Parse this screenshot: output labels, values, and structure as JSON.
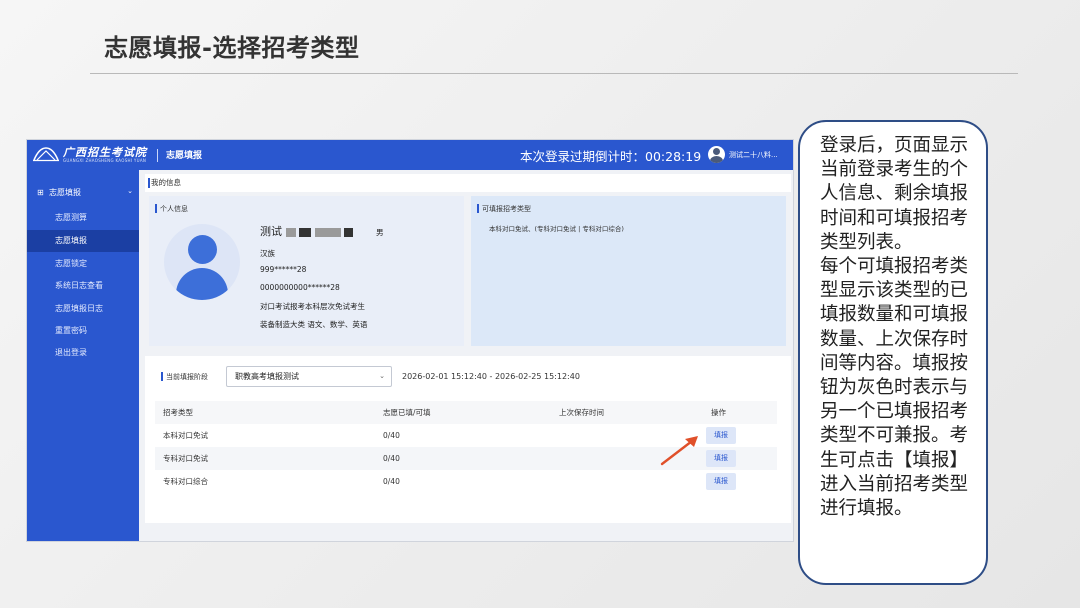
{
  "slide": {
    "title": "志愿填报-选择招考类型"
  },
  "app": {
    "logo_text": "广西招生考试院",
    "logo_subtitle": "GUANGXI ZHAOSHENG KAOSHI YUAN",
    "module_title": "志愿填报",
    "countdown_label": "本次登录过期倒计时：",
    "countdown_value": "00:28:19",
    "user_name": "测试二十八料..."
  },
  "sidebar": {
    "group_label": "志愿填报",
    "items": [
      {
        "label": "志愿测算"
      },
      {
        "label": "志愿填报"
      },
      {
        "label": "志愿锁定"
      },
      {
        "label": "系统日志查看"
      },
      {
        "label": "志愿填报日志"
      },
      {
        "label": "重置密码"
      },
      {
        "label": "退出登录"
      }
    ]
  },
  "my_info": {
    "header": "我的信息",
    "personal_title": "个人信息",
    "name": "测试",
    "gender": "男",
    "ethnicity": "汉族",
    "exam_number": "999******28",
    "id_number": "0000000000******28",
    "category": "对口考试报考本科层次免试考生",
    "subjects": "装备制造大类    语文、数学、英语",
    "types_title": "可填报招考类型",
    "types_text": "本科对口免试、(专科对口免试 | 专科对口综合)"
  },
  "apply": {
    "stage_label": "当前填报阶段",
    "stage_value": "职教高考填报测试",
    "stage_range": "2026-02-01 15:12:40 - 2026-02-25 15:12:40",
    "columns": [
      "招考类型",
      "志愿已填/可填",
      "上次保存时间",
      "操作"
    ],
    "rows": [
      {
        "type": "本科对口免试",
        "count": "0/40",
        "saved": "",
        "action": "填报"
      },
      {
        "type": "专科对口免试",
        "count": "0/40",
        "saved": "",
        "action": "填报"
      },
      {
        "type": "专科对口综合",
        "count": "0/40",
        "saved": "",
        "action": "填报"
      }
    ]
  },
  "note": {
    "text": "登录后，页面显示当前登录考生的个人信息、剩余填报时间和可填报招考类型列表。\n每个可填报招考类型显示该类型的已填报数量和可填报数量、上次保存时间等内容。填报按钮为灰色时表示与另一个已填报招考类型不可兼报。考生可点击【填报】进入当前招考类型进行填报。"
  },
  "colors": {
    "brand_blue": "#2a57cf",
    "sidebar_active": "#1b3fa3",
    "arrow": "#e0502a",
    "note_border": "#2e4d86"
  }
}
